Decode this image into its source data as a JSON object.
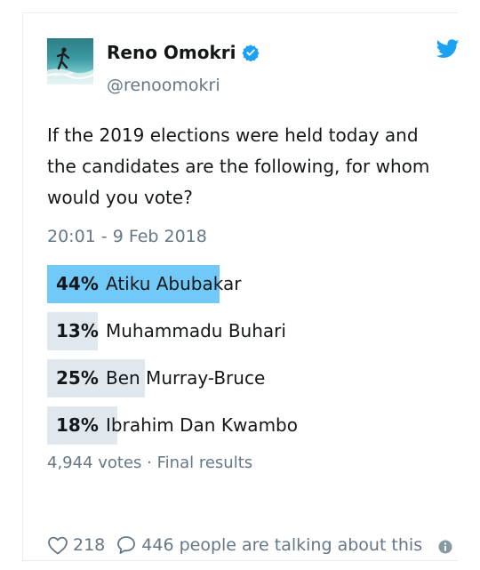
{
  "author": {
    "display_name": "Reno Omokri",
    "handle": "@renoomokri",
    "verified": true
  },
  "tweet": {
    "text": "If the 2019 elections were held today and the candidates are the following, for whom would you vote?",
    "timestamp": "20:01 - 9 Feb 2018"
  },
  "poll": {
    "choices": [
      {
        "percent_label": "44%",
        "percent": 44,
        "label": "Atiku Abubakar",
        "winner": true
      },
      {
        "percent_label": "13%",
        "percent": 13,
        "label": "Muhammadu Buhari",
        "winner": false
      },
      {
        "percent_label": "25%",
        "percent": 25,
        "label": "Ben Murray-Bruce",
        "winner": false
      },
      {
        "percent_label": "18%",
        "percent": 18,
        "label": "Ibrahim Dan Kwambo",
        "winner": false
      }
    ],
    "votes": "4,944 votes",
    "separator": "·",
    "status": "Final results"
  },
  "footer": {
    "likes": "218",
    "talking": "446 people are talking about this"
  },
  "colors": {
    "winner_bar": "#71c9f8",
    "other_bar": "#e1e8ed",
    "brand_blue": "#1da1f2",
    "muted_text": "#657786"
  },
  "icons": {
    "verified": "verified-badge-icon",
    "brand": "twitter-bird-icon",
    "like": "heart-icon",
    "reply": "speech-bubble-icon",
    "info": "info-icon"
  }
}
